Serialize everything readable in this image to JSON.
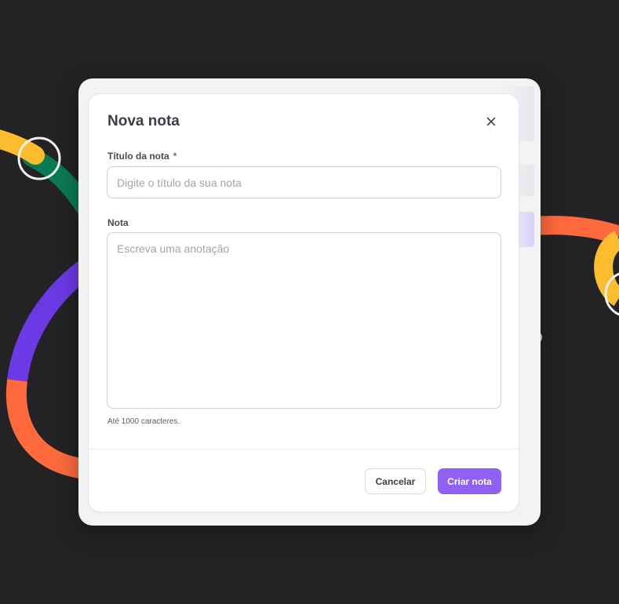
{
  "modal": {
    "title": "Nova nota",
    "close_icon": "close-icon",
    "title_field": {
      "label": "Título da nota",
      "required_mark": "*",
      "value": "",
      "placeholder": "Digite o título da sua nota"
    },
    "note_field": {
      "label": "Nota",
      "value": "",
      "placeholder": "Escreva uma anotação",
      "helper": "Até 1000 caracteres."
    },
    "actions": {
      "cancel_label": "Cancelar",
      "submit_label": "Criar nota"
    }
  },
  "colors": {
    "background": "#232325",
    "primary": "#9061f5",
    "decor_yellow": "#fbbd2e",
    "decor_green": "#0a7a55",
    "decor_purple": "#6b3ae6",
    "decor_orange": "#ff6a3d"
  }
}
